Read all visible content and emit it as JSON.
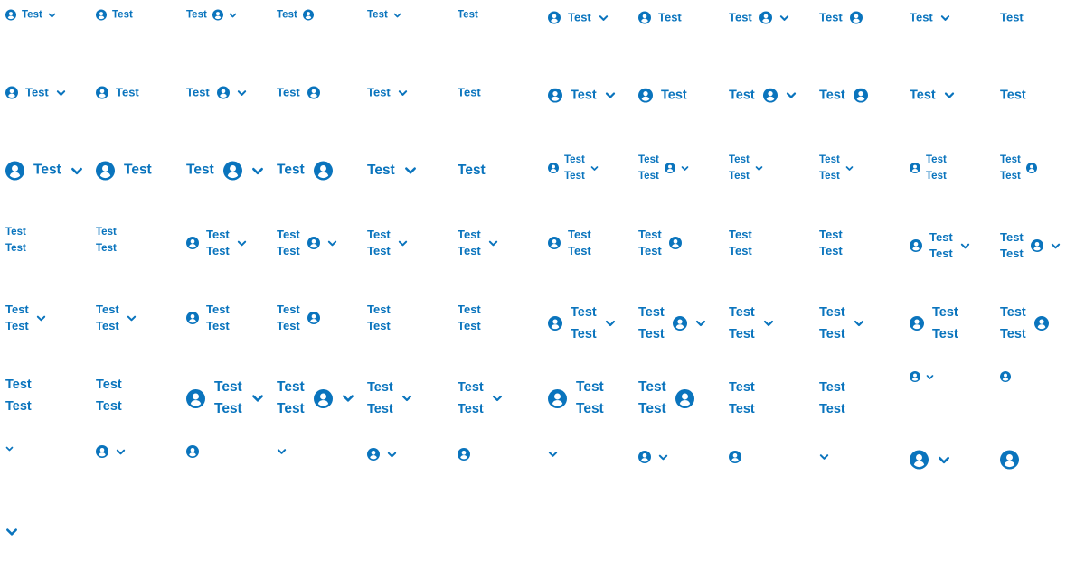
{
  "colors": {
    "accent": "#0a74bd",
    "background": "#ffffff"
  },
  "icons": {
    "user": "user-circle-icon",
    "chevron": "chevron-down-icon"
  },
  "button": {
    "label": "Test"
  }
}
